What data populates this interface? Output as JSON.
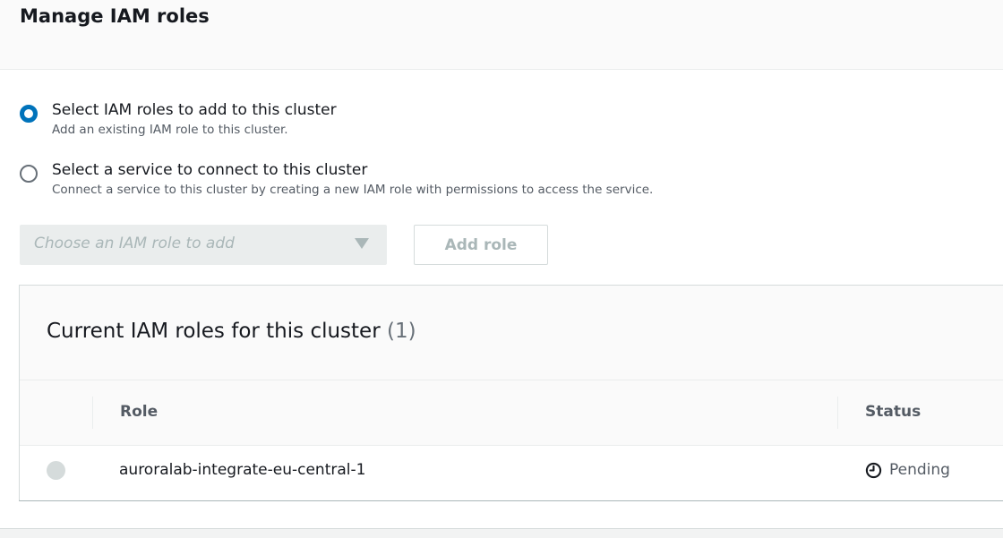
{
  "header": {
    "title": "Manage IAM roles"
  },
  "options": [
    {
      "label": "Select IAM roles to add to this cluster",
      "description": "Add an existing IAM role to this cluster.",
      "checked": true
    },
    {
      "label": "Select a service to connect to this cluster",
      "description": "Connect a service to this cluster by creating a new IAM role with permissions to access the service.",
      "checked": false
    }
  ],
  "role_select": {
    "placeholder": "Choose an IAM role to add"
  },
  "add_role_button": {
    "label": "Add role"
  },
  "roles_panel": {
    "title": "Current IAM roles for this cluster",
    "count": "(1)",
    "columns": {
      "role": "Role",
      "status": "Status"
    },
    "rows": [
      {
        "role": "auroralab-integrate-eu-central-1",
        "status": "Pending",
        "status_icon": "clock-icon"
      }
    ]
  },
  "colors": {
    "accent": "#0073bb",
    "disabled_text": "#aab7b8",
    "text": "#16191f"
  }
}
